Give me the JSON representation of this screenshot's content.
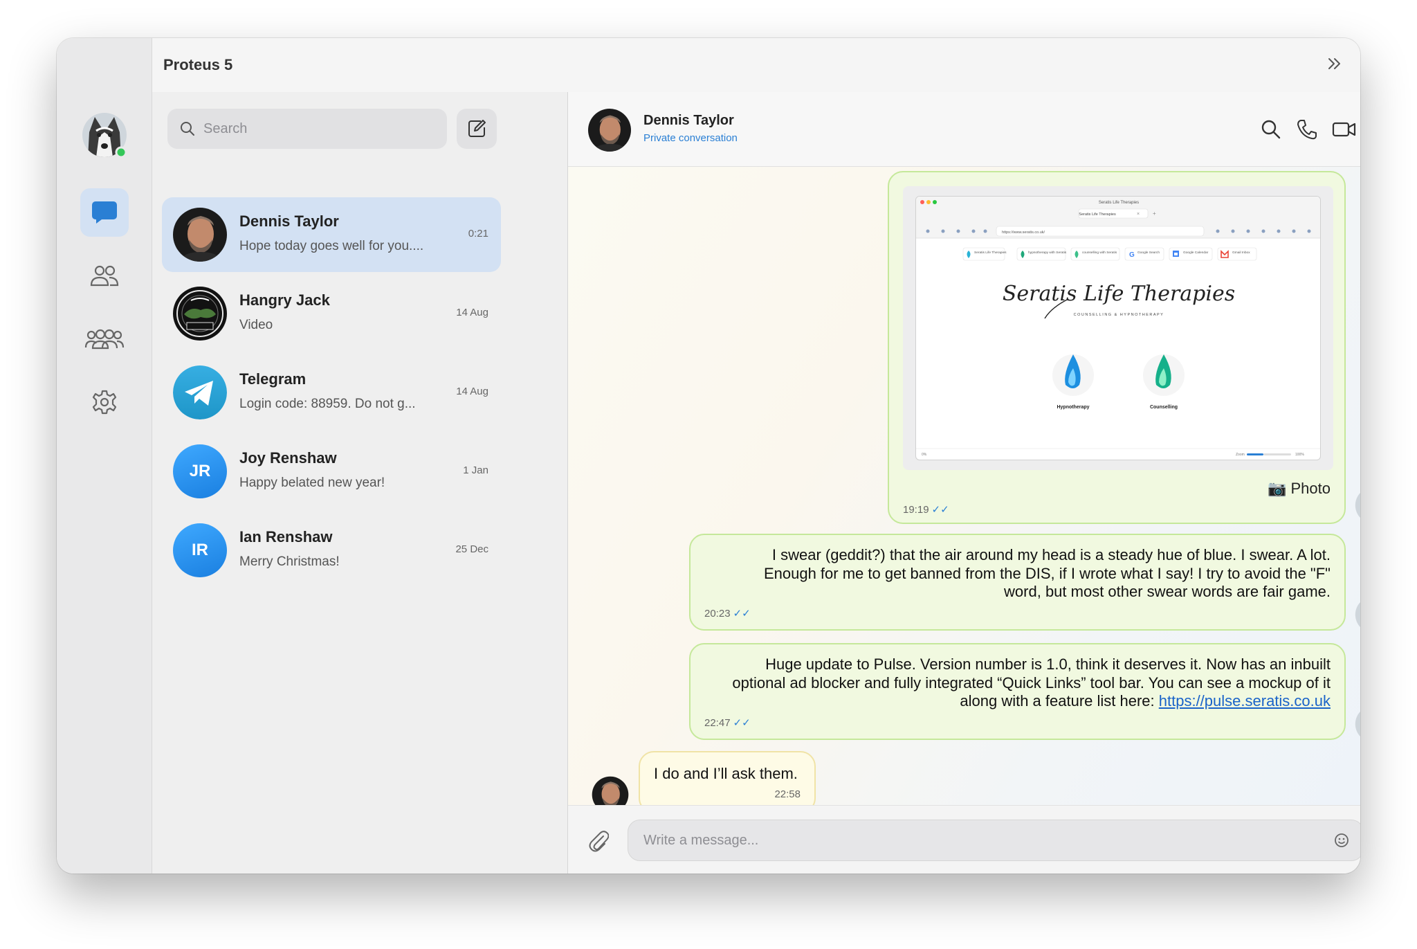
{
  "app": {
    "title": "Proteus 5"
  },
  "search": {
    "placeholder": "Search"
  },
  "chats": [
    {
      "name": "Dennis Taylor",
      "preview": "Hope today goes well for you....",
      "time": "0:21",
      "active": true,
      "avatar": "photo-dennis"
    },
    {
      "name": "Hangry Jack",
      "preview": "Video",
      "time": "14 Aug",
      "active": false,
      "avatar": "photo-hangry"
    },
    {
      "name": "Telegram",
      "preview": "Login code: 88959. Do not g...",
      "time": "14 Aug",
      "active": false,
      "avatar": "telegram-icon"
    },
    {
      "name": "Joy Renshaw",
      "preview": "Happy belated new year!",
      "time": "1 Jan",
      "active": false,
      "initials": "JR"
    },
    {
      "name": "Ian Renshaw",
      "preview": "Merry Christmas!",
      "time": "25 Dec",
      "active": false,
      "initials": "IR"
    }
  ],
  "conversation": {
    "name": "Dennis Taylor",
    "subtitle": "Private conversation",
    "messages": [
      {
        "type": "photo",
        "caption": "📷 Photo",
        "time": "19:19",
        "ticks": "✓✓"
      },
      {
        "type": "text",
        "lines": [
          "I swear (geddit?) that the air around my head is a steady hue of blue. I swear. A lot.",
          "Enough for me to get banned from the DIS, if I wrote what I say! I try to avoid the \"F\"",
          "word, but most other swear words are fair game."
        ],
        "time": "20:23",
        "ticks": "✓✓"
      },
      {
        "type": "text",
        "lines": [
          "Huge update to Pulse. Version number is 1.0, think it deserves it. Now has an inbuilt",
          "optional ad blocker and fully integrated “Quick Links” tool bar. You can see a mockup of it",
          "along with a feature list here: "
        ],
        "link": "https://pulse.seratis.co.uk",
        "time": "22:47",
        "ticks": "✓✓"
      },
      {
        "type": "incoming",
        "text": "I do and I’ll ask them.",
        "time": "22:58"
      }
    ]
  },
  "composer": {
    "placeholder": "Write a message..."
  },
  "screenshot_preview": {
    "window_title": "Seratis Life Therapies",
    "tab": "Seratis Life Therapies",
    "url": "https://www.seratis.co.uk/",
    "quick_links": [
      "Seratis Life Therapies",
      "hypnotherapy with Seratis",
      "counselling with Seratis",
      "Google Search",
      "Google Calendar",
      "Gmail Inbox"
    ],
    "logo_text": "Seratis Life Therapies",
    "logo_sub": "COUNSELLING & HYPNOTHERAPY",
    "cards": [
      "Hypnotherapy",
      "Counselling"
    ],
    "status_left": "0%",
    "zoom_label": "Zoom",
    "zoom_value": "100%"
  },
  "colors": {
    "accent": "#2a7fd4",
    "active_row": "#d3e1f3",
    "outgoing_bubble": "#f1f9e0",
    "incoming_bubble": "#fefbe6",
    "online": "#34c759"
  }
}
